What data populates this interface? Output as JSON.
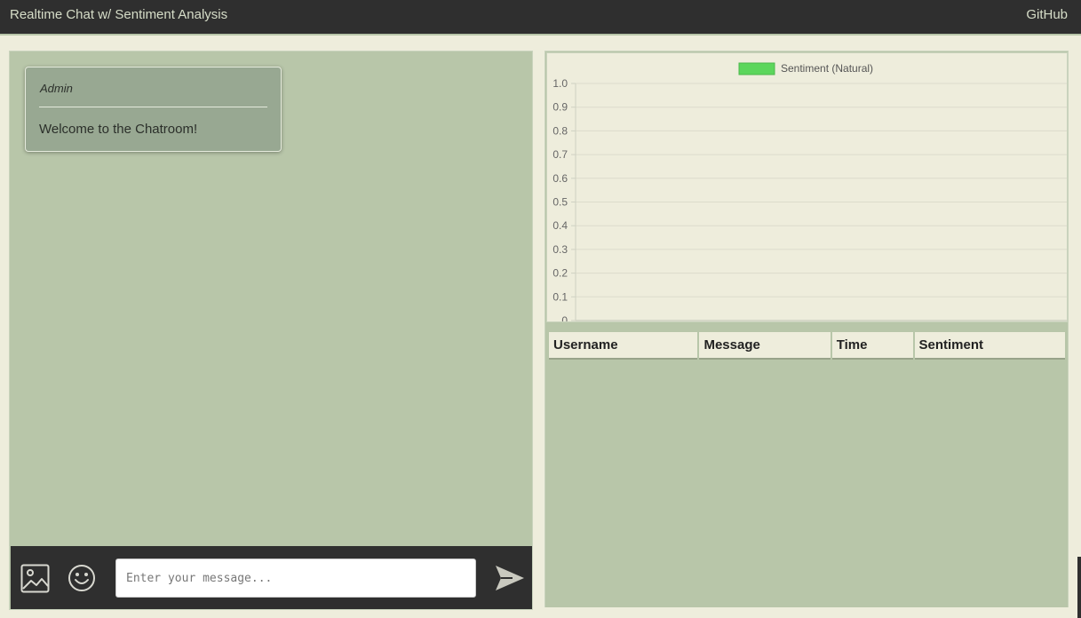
{
  "navbar": {
    "brand": "Realtime Chat w/ Sentiment Analysis",
    "github_link": "GitHub"
  },
  "chat": {
    "messages": [
      {
        "author": "Admin",
        "text": "Welcome to the Chatroom!"
      }
    ],
    "input": {
      "placeholder": "Enter your message...",
      "value": ""
    },
    "icons": {
      "image": "image-icon",
      "emoji": "emoji-icon",
      "send": "send-icon"
    }
  },
  "chart_data": {
    "type": "line",
    "title": "",
    "xlabel": "",
    "ylabel": "",
    "ylim": [
      0,
      1.0
    ],
    "y_ticks": [
      "0",
      "0.1",
      "0.2",
      "0.3",
      "0.4",
      "0.5",
      "0.6",
      "0.7",
      "0.8",
      "0.9",
      "1.0"
    ],
    "legend_position": "top",
    "grid": true,
    "series": [
      {
        "name": "Sentiment (Natural)",
        "color": "#5cd65c",
        "values": []
      }
    ],
    "x": []
  },
  "table": {
    "columns": [
      "Username",
      "Message",
      "Time",
      "Sentiment"
    ],
    "rows": []
  },
  "colors": {
    "navbar": "#2f2f2f",
    "panel": "#b8c6a9",
    "card": "#98a892",
    "background": "#eeeddc",
    "legend_swatch": "#5cd65c"
  }
}
